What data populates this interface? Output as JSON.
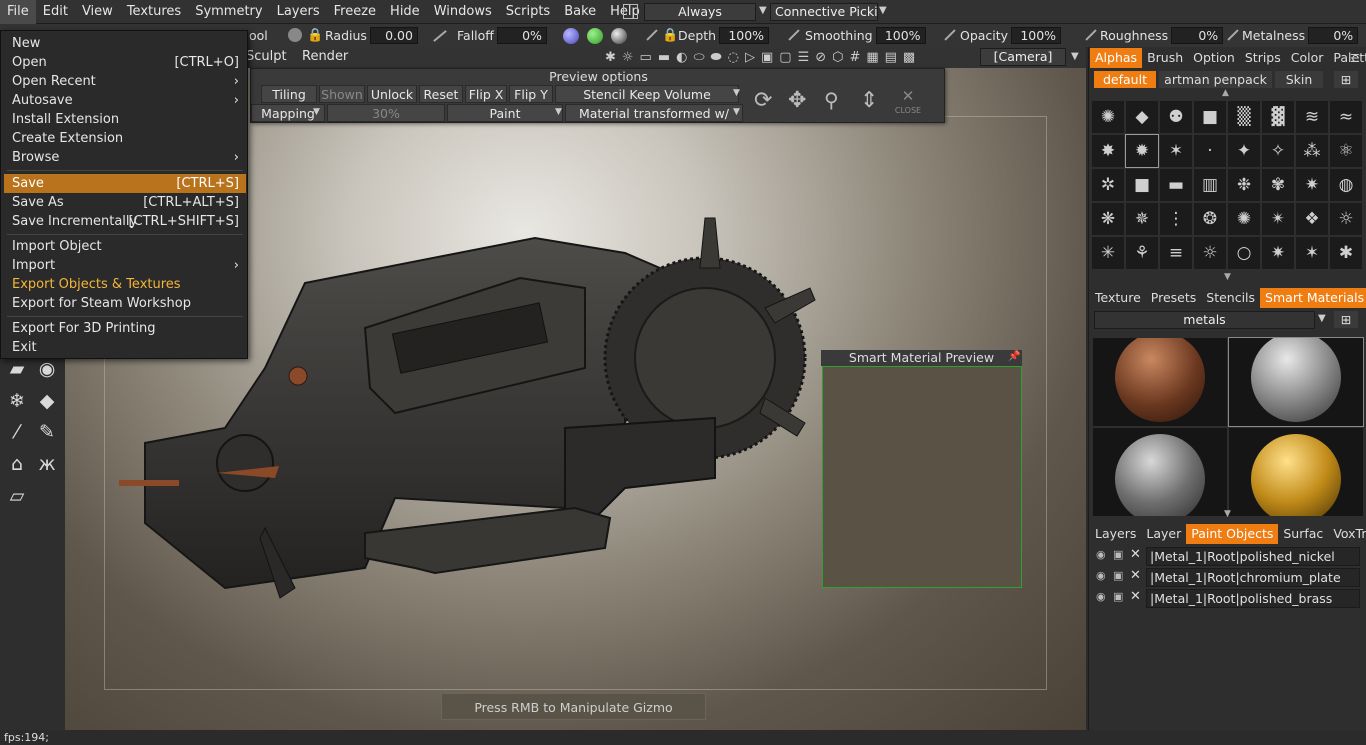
{
  "menubar": {
    "items": [
      "File",
      "Edit",
      "View",
      "Textures",
      "Symmetry",
      "Layers",
      "Freeze",
      "Hide",
      "Windows",
      "Scripts",
      "Bake",
      "Help"
    ],
    "always_label": "Always",
    "connective_label": "Connective Picki"
  },
  "toolbar": {
    "tool_label": "ool",
    "radius_label": "Radius",
    "radius_value": "0.00",
    "falloff_label": "Falloff",
    "falloff_value": "0%",
    "depth_label": "Depth",
    "depth_value": "100%",
    "smoothing_label": "Smoothing",
    "smoothing_value": "100%",
    "opacity_label": "Opacity",
    "opacity_value": "100%",
    "roughness_label": "Roughness",
    "roughness_value": "0%",
    "metalness_label": "Metalness",
    "metalness_value": "0%",
    "camera_label": "[Camera]",
    "sculpt_tab": "Sculpt",
    "render_tab": "Render"
  },
  "file_menu": {
    "items": [
      {
        "label": "New",
        "shortcut": ""
      },
      {
        "label": "Open",
        "shortcut": "[CTRL+O]"
      },
      {
        "label": "Open Recent",
        "shortcut": "›"
      },
      {
        "label": "Autosave",
        "shortcut": "›"
      },
      {
        "label": "Install Extension",
        "shortcut": ""
      },
      {
        "label": "Create Extension",
        "shortcut": ""
      },
      {
        "label": "Browse",
        "shortcut": "›"
      },
      {
        "label": "Save",
        "shortcut": "[CTRL+S]"
      },
      {
        "label": "Save As",
        "shortcut": "[CTRL+ALT+S]"
      },
      {
        "label": "Save Incrementally",
        "shortcut": "[CTRL+SHIFT+S]"
      },
      {
        "label": "Import Object",
        "shortcut": ""
      },
      {
        "label": "Import",
        "shortcut": "›"
      },
      {
        "label": "Export Objects & Textures",
        "shortcut": ""
      },
      {
        "label": "Export for Steam Workshop",
        "shortcut": ""
      },
      {
        "label": "Export For 3D Printing",
        "shortcut": ""
      },
      {
        "label": "Exit",
        "shortcut": ""
      }
    ]
  },
  "preview_options": {
    "title": "Preview options",
    "tiling": "Tiling",
    "shown": "Shown",
    "unlock": "Unlock",
    "reset": "Reset",
    "flip_x": "Flip X",
    "flip_y": "Flip Y",
    "stencil": "Stencil Keep Volume",
    "mapping": "Mapping",
    "percent": "30%",
    "paint": "Paint",
    "material": "Material transformed w/",
    "close": "CLOSE"
  },
  "right_panel": {
    "top_tabs": [
      "Alphas",
      "Brush",
      "Option",
      "Strips",
      "Color",
      "Palette"
    ],
    "alpha_sets": [
      "default",
      "artman penpack",
      "Skin"
    ],
    "material_tabs": [
      "Texture",
      "Presets",
      "Stencils",
      "Smart Materials"
    ],
    "material_filter": "metals",
    "layer_tabs": [
      "Layers",
      "Layer",
      "Paint Objects",
      "Surfac",
      "VoxTre"
    ],
    "paint_objects": [
      "|Metal_1|Root|polished_nickel",
      "|Metal_1|Root|chromium_plate",
      "|Metal_1|Root|polished_brass"
    ]
  },
  "smart_material_preview": {
    "title": "Smart Material Preview"
  },
  "viewport": {
    "hint": "Press RMB to Manipulate Gizmo"
  },
  "status": {
    "fps": "fps:194;"
  },
  "colors": {
    "accent": "#ef7d12",
    "menu_highlight": "#b8731c",
    "export_text": "#f3b53a"
  }
}
